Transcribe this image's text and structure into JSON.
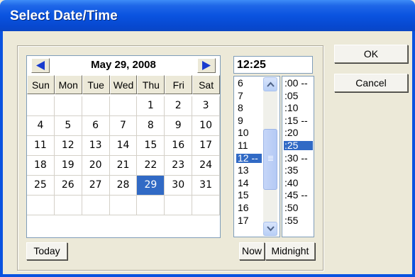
{
  "window": {
    "title": "Select Date/Time"
  },
  "calendar": {
    "month_label": "May 29, 2008",
    "weekdays": [
      "Sun",
      "Mon",
      "Tue",
      "Wed",
      "Thu",
      "Fri",
      "Sat"
    ],
    "weeks": [
      [
        "",
        "",
        "",
        "",
        "1",
        "2",
        "3"
      ],
      [
        "4",
        "5",
        "6",
        "7",
        "8",
        "9",
        "10"
      ],
      [
        "11",
        "12",
        "13",
        "14",
        "15",
        "16",
        "17"
      ],
      [
        "18",
        "19",
        "20",
        "21",
        "22",
        "23",
        "24"
      ],
      [
        "25",
        "26",
        "27",
        "28",
        "29",
        "30",
        "31"
      ],
      [
        "",
        "",
        "",
        "",
        "",
        "",
        ""
      ]
    ],
    "selected_day": "29",
    "prev_icon": "left-arrow-icon",
    "next_icon": "right-arrow-icon"
  },
  "today_label": "Today",
  "time": {
    "value": "12:25",
    "hours": [
      "6",
      "7",
      "8",
      "9",
      "10",
      "11",
      "12 --",
      "13",
      "14",
      "15",
      "16",
      "17"
    ],
    "selected_hour": "12 --",
    "minutes": [
      ":00 --",
      ":05",
      ":10",
      ":15 --",
      ":20",
      ":25",
      ":30 --",
      ":35",
      ":40",
      ":45 --",
      ":50",
      ":55"
    ],
    "selected_minute": ":25"
  },
  "now_label": "Now",
  "midnight_label": "Midnight",
  "ok_label": "OK",
  "cancel_label": "Cancel",
  "colors": {
    "selection": "#316ac5",
    "title_bar": "#0a53e0",
    "dialog_bg": "#ece9d8"
  }
}
